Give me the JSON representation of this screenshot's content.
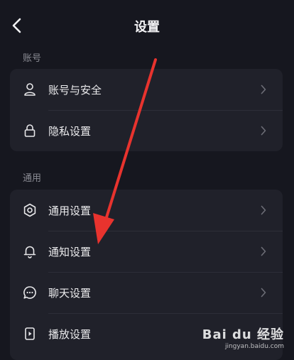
{
  "header": {
    "title": "设置"
  },
  "sections": [
    {
      "label": "账号",
      "items": [
        {
          "label": "账号与安全",
          "icon": "person-icon"
        },
        {
          "label": "隐私设置",
          "icon": "lock-icon"
        }
      ]
    },
    {
      "label": "通用",
      "items": [
        {
          "label": "通用设置",
          "icon": "gear-icon"
        },
        {
          "label": "通知设置",
          "icon": "bell-icon"
        },
        {
          "label": "聊天设置",
          "icon": "chat-bubble-icon"
        },
        {
          "label": "播放设置",
          "icon": "play-device-icon"
        }
      ]
    }
  ],
  "annotation": {
    "color": "#e8332e"
  },
  "watermark": {
    "main": "Bai du 经验",
    "sub": "jingyan.baidu.com"
  }
}
